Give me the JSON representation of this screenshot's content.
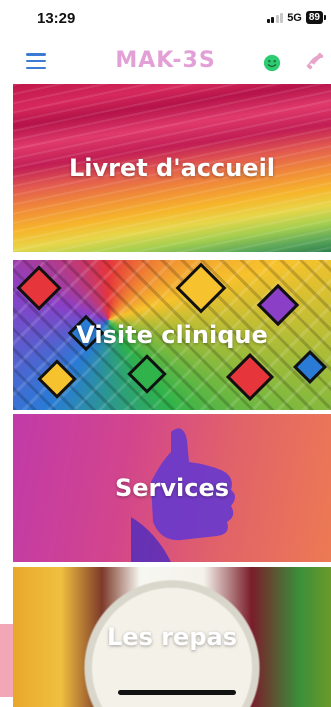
{
  "status_bar": {
    "time": "13:29",
    "network": "5G",
    "battery": "89"
  },
  "header": {
    "title": "MAK-3S",
    "title_color": "#e2a0d6",
    "menu_icon": "hamburger-menu-icon",
    "smiley_icon": "smiley-icon",
    "phone_icon": "phone-icon"
  },
  "tiles": [
    {
      "label": "Livret d'accueil"
    },
    {
      "label": "Visite clinique"
    },
    {
      "label": "Services"
    },
    {
      "label": "Les repas"
    }
  ],
  "colors": {
    "accent_blue": "#3a7bd5",
    "smiley_green": "#2ecc71",
    "phone_pink": "#e7a6c9"
  }
}
